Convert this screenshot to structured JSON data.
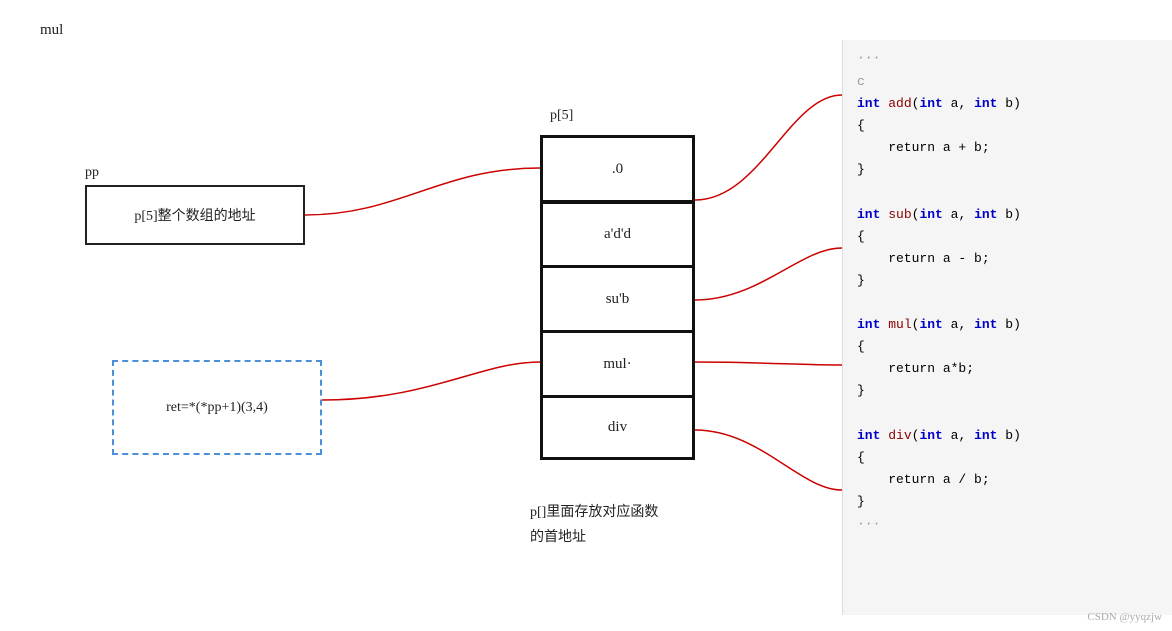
{
  "top_label": "mul",
  "pp": {
    "label": "pp",
    "box_text": "p[5]整个数组的地址"
  },
  "ret": {
    "box_text": "ret=*(*pp+1)(3,4)"
  },
  "p5": {
    "label": "p[5]",
    "cells": [
      ".0",
      "a'd'd",
      "su'b",
      "mul·",
      "div"
    ]
  },
  "desc": {
    "line1": "p[]里面存放对应函数",
    "line2": "的首地址"
  },
  "code": {
    "ellipsis_top": "...",
    "c_comment": "c",
    "lines": [
      {
        "type": "func",
        "text": "int add(int a, int b)"
      },
      {
        "type": "brace",
        "text": "{"
      },
      {
        "type": "body",
        "text": "    return a + b;"
      },
      {
        "type": "brace",
        "text": "}"
      },
      {
        "type": "empty",
        "text": ""
      },
      {
        "type": "func",
        "text": "int sub(int a, int b)"
      },
      {
        "type": "brace",
        "text": "{"
      },
      {
        "type": "body",
        "text": "    return a - b;"
      },
      {
        "type": "brace",
        "text": "}"
      },
      {
        "type": "empty",
        "text": ""
      },
      {
        "type": "func",
        "text": "int mul(int a, int b)"
      },
      {
        "type": "brace",
        "text": "{"
      },
      {
        "type": "body",
        "text": "    return a*b;"
      },
      {
        "type": "brace",
        "text": "}"
      },
      {
        "type": "empty",
        "text": ""
      },
      {
        "type": "func",
        "text": "int div(int a, int b)"
      },
      {
        "type": "brace",
        "text": "{"
      },
      {
        "type": "body",
        "text": "    return a / b;"
      },
      {
        "type": "brace",
        "text": "}"
      },
      {
        "type": "ellipsis",
        "text": "..."
      }
    ]
  },
  "watermark": "CSDN @yyqzjw"
}
